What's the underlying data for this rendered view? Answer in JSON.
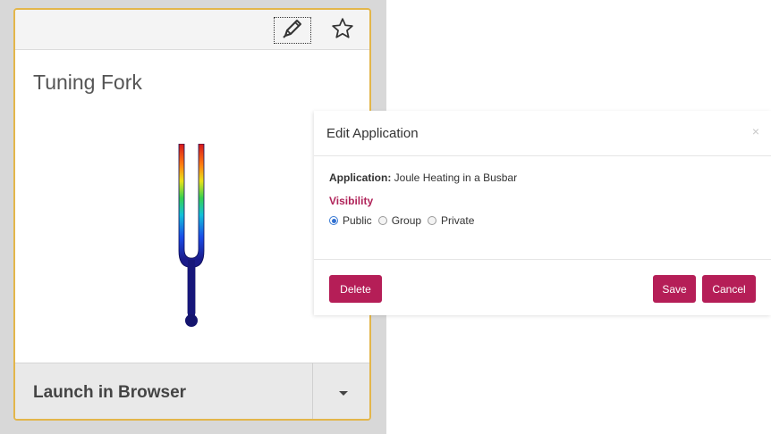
{
  "card": {
    "title": "Tuning Fork",
    "edit_icon": "pencil-icon",
    "favorite_icon": "star-icon",
    "launch_label": "Launch in Browser",
    "dropdown_icon": "caret-down-icon",
    "accent_color": "#e3b64a"
  },
  "modal": {
    "title": "Edit Application",
    "close_glyph": "×",
    "application_label": "Application:",
    "application_value": "Joule Heating in a Busbar",
    "visibility_label": "Visibility",
    "visibility_options": [
      "Public",
      "Group",
      "Private"
    ],
    "visibility_selected": "Public",
    "buttons": {
      "delete": "Delete",
      "save": "Save",
      "cancel": "Cancel"
    },
    "button_color": "#b51e57"
  }
}
